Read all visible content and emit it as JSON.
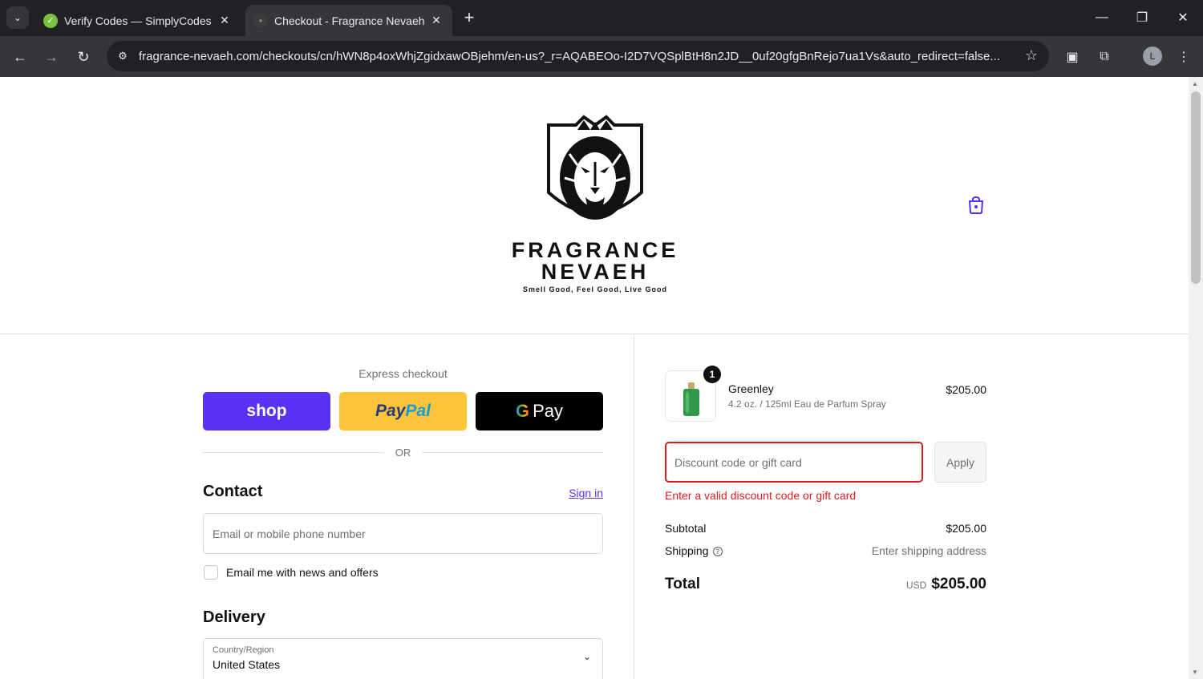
{
  "browser": {
    "tabs": [
      {
        "title": "Verify Codes — SimplyCodes",
        "close": "✕"
      },
      {
        "title": "Checkout - Fragrance Nevaeh",
        "close": "✕"
      }
    ],
    "new_tab": "+",
    "url": "fragrance-nevaeh.com/checkouts/cn/hWN8p4oxWhjZgidxawOBjehm/en-us?_r=AQABEOo-I2D7VQSplBtH8n2JD__0uf20gfgBnRejo7ua1Vs&auto_redirect=false...",
    "profile_initial": "L"
  },
  "header": {
    "brand_line1": "FRAGRANCE",
    "brand_line2": "NEVAEH",
    "tagline": "Smell Good, Feel Good, Live Good"
  },
  "express": {
    "label": "Express checkout",
    "shop": "shop",
    "paypal_a": "Pay",
    "paypal_b": "Pal",
    "gpay_g": "G",
    "gpay_text": "Pay",
    "or": "OR"
  },
  "contact": {
    "heading": "Contact",
    "sign_in": "Sign in",
    "email_placeholder": "Email or mobile phone number",
    "newsletter_label": "Email me with news and offers"
  },
  "delivery": {
    "heading": "Delivery",
    "country_label": "Country/Region",
    "country_value": "United States"
  },
  "summary": {
    "quantity": "1",
    "product_name": "Greenley",
    "product_desc": "4.2 oz. / 125ml Eau de Parfum Spray",
    "product_price": "$205.00",
    "discount_placeholder": "Discount code or gift card",
    "apply": "Apply",
    "error": "Enter a valid discount code or gift card",
    "subtotal_label": "Subtotal",
    "subtotal_value": "$205.00",
    "shipping_label": "Shipping",
    "shipping_value": "Enter shipping address",
    "total_label": "Total",
    "currency": "USD",
    "total_value": "$205.00"
  },
  "colors": {
    "shop_purple": "#5a31f4",
    "paypal_yellow": "#ffc439",
    "error_red": "#dd1d1d"
  }
}
